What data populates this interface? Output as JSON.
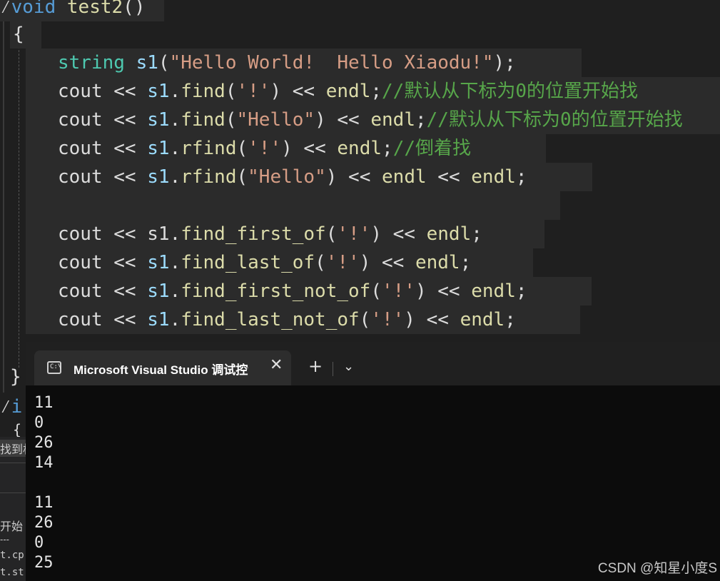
{
  "editor": {
    "function_decl": {
      "kw": "void",
      "name": "test2",
      "parens": "()"
    },
    "open_brace": "{",
    "close_brace": "}",
    "partial_keyword": "i",
    "partial_brace": "{",
    "line1": {
      "type": "string",
      "var": "s1",
      "open": "(",
      "literal": "\"Hello World!  Hello Xiaodu!\"",
      "close": ");"
    },
    "line2": {
      "cout": "cout",
      "op": " << ",
      "obj": "s1",
      "dot": ".",
      "fn": "find",
      "open": "(",
      "arg": "'!'",
      "close": ")",
      "op2": " << ",
      "endl": "endl",
      "semi": ";",
      "comment": "//默认从下标为0的位置开始找"
    },
    "line3": {
      "cout": "cout",
      "op": " << ",
      "obj": "s1",
      "dot": ".",
      "fn": "find",
      "open": "(",
      "arg": "\"Hello\"",
      "close": ")",
      "op2": " << ",
      "endl": "endl",
      "semi": ";",
      "comment": "//默认从下标为0的位置开始找"
    },
    "line4": {
      "cout": "cout",
      "op": " << ",
      "obj": "s1",
      "dot": ".",
      "fn": "rfind",
      "open": "(",
      "arg": "'!'",
      "close": ")",
      "op2": " << ",
      "endl": "endl",
      "semi": ";",
      "comment": "//倒着找"
    },
    "line5": {
      "cout": "cout",
      "op": " << ",
      "obj": "s1",
      "dot": ".",
      "fn": "rfind",
      "open": "(",
      "arg": "\"Hello\"",
      "close": ")",
      "op2": " << ",
      "endl": "endl",
      "op3": " << ",
      "endl2": "endl",
      "semi": ";"
    },
    "line6": {
      "cout": "cout",
      "op": " << ",
      "obj": "s1",
      "dot": ".",
      "fn": "find_first_of",
      "open": "(",
      "arg": "'!'",
      "close": ")",
      "op2": " << ",
      "endl": "endl",
      "semi": ";"
    },
    "line7": {
      "cout": "cout",
      "op": " << ",
      "obj": "s1",
      "dot": ".",
      "fn": "find_last_of",
      "open": "(",
      "arg": "'!'",
      "close": ")",
      "op2": " << ",
      "endl": "endl",
      "semi": ";"
    },
    "line8": {
      "cout": "cout",
      "op": " << ",
      "obj": "s1",
      "dot": ".",
      "fn": "find_first_not_of",
      "open": "(",
      "arg": "'!'",
      "close": ")",
      "op2": " << ",
      "endl": "endl",
      "semi": ";"
    },
    "line9": {
      "cout": "cout",
      "op": " << ",
      "obj": "s1",
      "dot": ".",
      "fn": "find_last_not_of",
      "open": "(",
      "arg": "'!'",
      "close": ")",
      "op2": " << ",
      "endl": "endl",
      "semi": ";"
    }
  },
  "side_panel": {
    "text1": "找到相",
    "text2": "开始",
    "text3": "---",
    "text4": "t.cp",
    "text5": "t.st"
  },
  "terminal": {
    "tab_title": "Microsoft Visual Studio 调试控制台",
    "tab_icon_text": "C:\\",
    "close_symbol": "✕",
    "new_tab_symbol": "+",
    "dropdown_symbol": "⌄",
    "output": [
      "11",
      "0",
      "26",
      "14",
      "",
      "11",
      "26",
      "0",
      "25"
    ]
  },
  "watermark": "CSDN @知星小度S",
  "colors": {
    "keyword": "#569cd6",
    "type": "#4ec9b0",
    "function": "#dcdcaa",
    "string": "#d69d85",
    "identifier": "#9cdcfe",
    "comment": "#57a64a",
    "editor_bg": "#1f1f1f",
    "terminal_bg": "#0c0c0c"
  }
}
